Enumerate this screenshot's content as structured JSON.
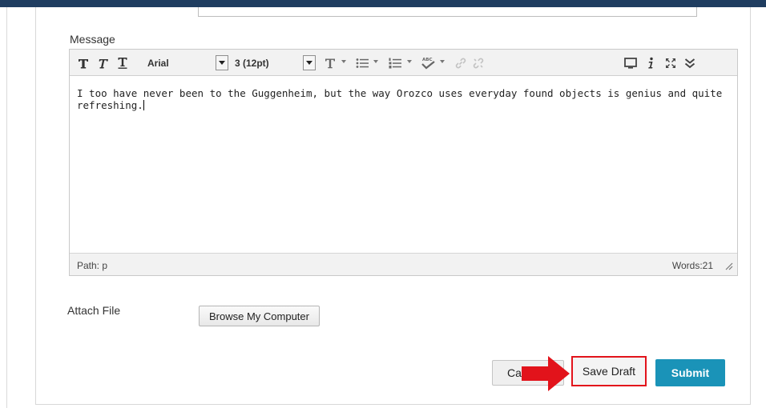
{
  "colors": {
    "top_bar": "#1f3d60",
    "submit_bg": "#1a93b8",
    "highlight_border": "#e2131b",
    "annotation_arrow": "#e2131b"
  },
  "message": {
    "label": "Message",
    "toolbar": {
      "font_family": "Arial",
      "font_size": "3 (12pt)",
      "icons": [
        "bold-icon",
        "italic-icon",
        "underline-icon",
        "text-color-icon",
        "bullet-list-icon",
        "numbered-list-icon",
        "spellcheck-icon",
        "link-icon",
        "unlink-icon",
        "preview-icon",
        "info-icon",
        "fullscreen-icon",
        "more-icon"
      ]
    },
    "body_text": "I too have never been to the Guggenheim, but the way Orozco uses everyday found objects is genius and quite refreshing.",
    "status": {
      "path": "Path: p",
      "words": "Words:21"
    }
  },
  "attach": {
    "label": "Attach File",
    "browse_button": "Browse My Computer"
  },
  "actions": {
    "cancel": "Cancel",
    "save_draft": "Save Draft",
    "submit": "Submit"
  }
}
